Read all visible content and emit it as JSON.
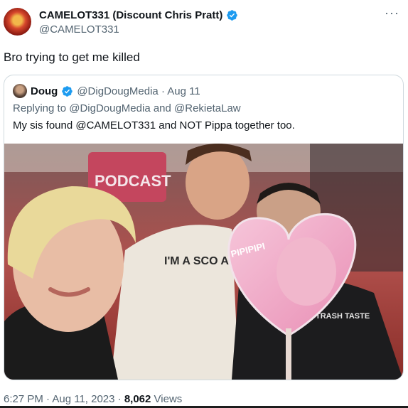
{
  "author": {
    "display_name": "CAMELOT331 (Discount Chris Pratt)",
    "handle": "@CAMELOT331"
  },
  "more_label": "···",
  "tweet_text": "Bro trying to get me killed",
  "quoted": {
    "name": "Doug",
    "handle_date": "@DigDougMedia · Aug 11",
    "replying_to": "Replying to @DigDougMedia and @RekietaLaw",
    "text": "My sis found @CAMELOT331 and NOT Pippa together too.",
    "photo_texts": {
      "shirt": "I'M A SCO AND PA",
      "fan": "PIPIPIPI",
      "shirt2": "TRASH TASTE",
      "banner": "PODCAST"
    }
  },
  "footer": {
    "time_date": "6:27 PM · Aug 11, 2023 · ",
    "views_count": "8,062",
    "views_label": " Views"
  },
  "colors": {
    "verified_blue": "#1d9bf0",
    "secondary_text": "#536471",
    "primary_text": "#0f1419",
    "border": "#cfd9de"
  }
}
